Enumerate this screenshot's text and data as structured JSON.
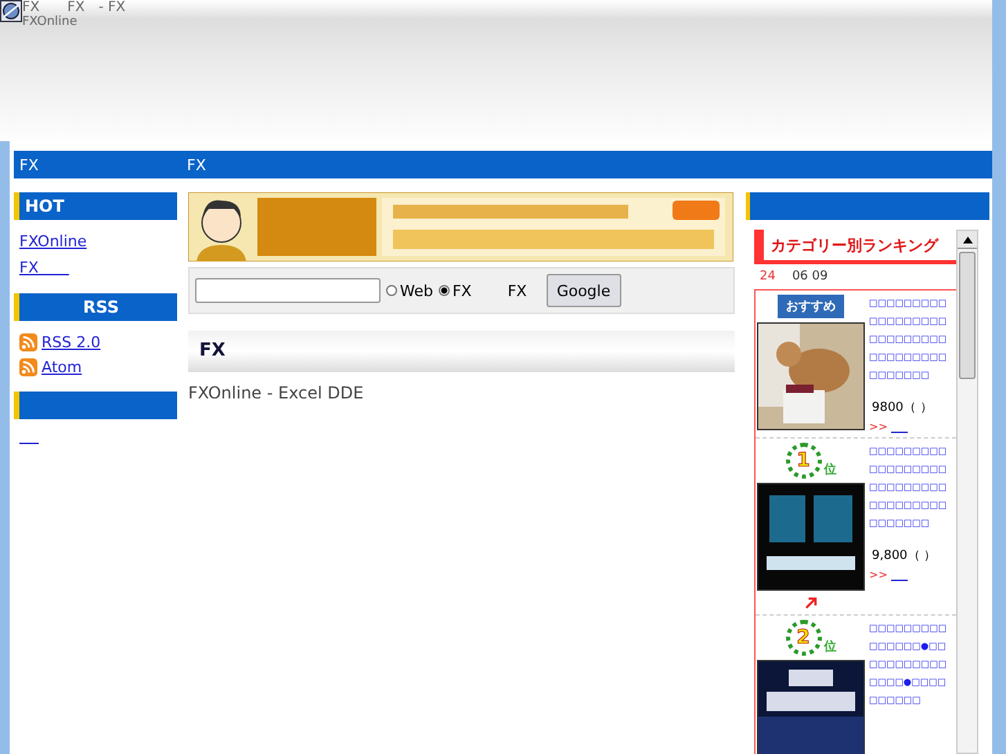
{
  "header": {
    "title": "FX　　FX　- FX",
    "subtitle": "FXOnline"
  },
  "nav": [
    "FX",
    "FX"
  ],
  "sidebar": [
    {
      "heading": "HOT",
      "links": [
        {
          "kind": "plain",
          "text": "FXOnline"
        },
        {
          "kind": "plain",
          "text": "FX　　"
        }
      ]
    },
    {
      "heading": "RSS",
      "links": [
        {
          "kind": "rss",
          "text": "RSS 2.0"
        },
        {
          "kind": "rss",
          "text": "Atom"
        }
      ]
    },
    {
      "links": [
        {
          "kind": "blank"
        }
      ]
    }
  ],
  "banner": {
    "kind": "picture"
  },
  "search": {
    "options": [
      {
        "label": "Web",
        "selected": false
      },
      {
        "label": "FX",
        "selected": true
      }
    ],
    "label": "FX",
    "button": "Google"
  },
  "section": {
    "title": "FX",
    "body": "FXOnline - Excel DDE"
  },
  "ranking": {
    "title": "カテゴリー別ランキング",
    "date_count": "24",
    "date": "06 09",
    "items": [
      {
        "kind": "recommend",
        "badge": "おすすめ",
        "text": "□□□□□□□□□□□□□□□□□□□□□□□□□□□□□□□□□□□□□□□□□□□",
        "price": "9800（ ）",
        "more": ">>",
        "arrow": false
      },
      {
        "kind": "rank",
        "rank": "1",
        "rank_suffix": "位",
        "text": "□□□□□□□□□□□□□□□□□□□□□□□□□□□□□□□□□□□□□□□□□□□",
        "price": "9,800（ ）",
        "more": ">>",
        "arrow": true
      },
      {
        "kind": "rank",
        "rank": "2",
        "rank_suffix": "位",
        "text": "□□□□□□□□□□□□□□□●□□□□□□□□□□□□□□□●□□□□□□□□□□",
        "arrow": false
      }
    ]
  }
}
